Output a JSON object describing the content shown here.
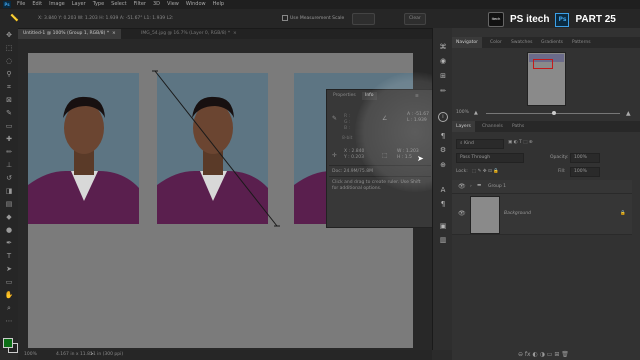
{
  "menu": {
    "items": [
      "File",
      "Edit",
      "Image",
      "Layer",
      "Type",
      "Select",
      "Filter",
      "3D",
      "View",
      "Window",
      "Help"
    ]
  },
  "options": {
    "readout": "X: 3.840    Y: 0.203    W: 1.203    H: 1.939    A: -51.67°    L1: 1.939    L2:",
    "use_measurement_scale": "Use Measurement Scale",
    "clear_button": "Clear"
  },
  "branding": {
    "channel": "PS itech",
    "part": "PART 25",
    "ps_mark": "Ps"
  },
  "tabs": {
    "active": "Untitled-1 @ 100% (Group 1, RGB/8) *",
    "inactive": "IMG_54.jpg @ 16.7% (Layer 0, RGB/8) *"
  },
  "info_panel": {
    "tab_properties": "Properties",
    "tab_info": "Info",
    "angle": "A : -51.67",
    "length": "L : 1.939",
    "units": "8-bit",
    "x_value": "X : 2.840",
    "y_value": "Y : 0.203",
    "w_value": "W : 1.203",
    "h_value": "H : 1.5",
    "doc": "Doc: 24.9M/75.8M",
    "hint": "Click and drag to create ruler.  Use Shift for additional options."
  },
  "status": {
    "zoom": "100%",
    "size": "4.167 in x 11.811 in (300 ppi)"
  },
  "navigator": {
    "tabs": [
      "Navigator",
      "Color",
      "Swatches",
      "Gradients",
      "Patterns"
    ],
    "zoom": "100%"
  },
  "layers": {
    "tabs": [
      "Layers",
      "Channels",
      "Paths"
    ],
    "filter_kind": "Kind",
    "blend_mode": "Pass Through",
    "opacity_label": "Opacity:",
    "opacity_value": "100%",
    "lock_label": "Lock:",
    "fill_label": "Fill:",
    "fill_value": "100%",
    "items": [
      "Group 1",
      "Background"
    ]
  },
  "colors": {
    "foreground": "#0c6e16",
    "photo_bg": "#5d7583",
    "canvas": "#7b7b7b"
  }
}
